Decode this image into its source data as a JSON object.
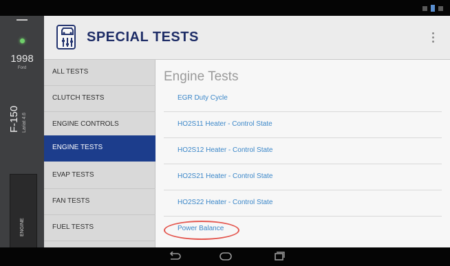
{
  "vehicle": {
    "year": "1998",
    "make": "Ford",
    "model": "F-150",
    "trim": "Lariat 4.6",
    "module_tab": "ENGINE"
  },
  "header": {
    "title": "SPECIAL TESTS"
  },
  "categories": [
    {
      "label": "ALL TESTS",
      "active": false
    },
    {
      "label": "CLUTCH TESTS",
      "active": false
    },
    {
      "label": "ENGINE CONTROLS",
      "active": false
    },
    {
      "label": "ENGINE TESTS",
      "active": true
    },
    {
      "label": "EVAP TESTS",
      "active": false
    },
    {
      "label": "FAN TESTS",
      "active": false
    },
    {
      "label": "FUEL TESTS",
      "active": false
    }
  ],
  "main": {
    "section_title": "Engine Tests",
    "tests": [
      "EGR Duty Cycle",
      "HO2S11 Heater - Control State",
      "HO2S12 Heater - Control State",
      "HO2S21 Heater - Control State",
      "HO2S22 Heater - Control State",
      "Power Balance"
    ]
  },
  "colors": {
    "accent": "#1c3d8c",
    "title": "#1d2c66",
    "link": "#3a86c8",
    "highlight": "#e4574f"
  },
  "icons": {
    "header": "car-diagnostic-icon",
    "more": "more-vert-icon",
    "back": "back-icon",
    "home": "home-icon",
    "recent": "recent-apps-icon"
  }
}
